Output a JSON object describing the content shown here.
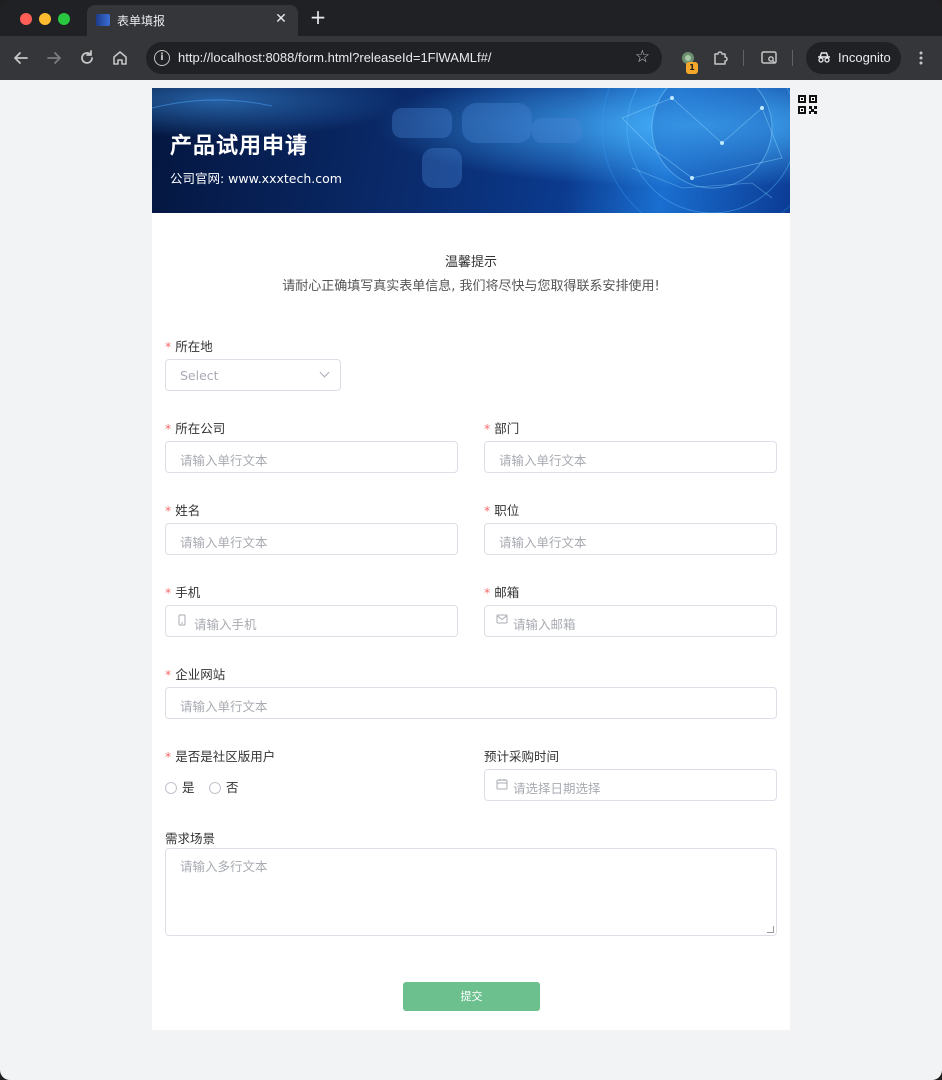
{
  "browser": {
    "tab_title": "表单填报",
    "tab_close": "✕",
    "new_tab": "+",
    "url": "http://localhost:8088/form.html?releaseId=1FlWAMLf#/",
    "extension_badge": "1",
    "incognito_label": "Incognito"
  },
  "banner": {
    "title": "产品试用申请",
    "subtitle": "公司官网: www.xxxtech.com"
  },
  "tip": {
    "title": "温馨提示",
    "text": "请耐心正确填写真实表单信息, 我们将尽快与您取得联系安排使用!"
  },
  "form": {
    "required_mark": "*",
    "location": {
      "label": "所在地",
      "placeholder": "Select"
    },
    "company": {
      "label": "所在公司",
      "placeholder": "请输入单行文本"
    },
    "department": {
      "label": "部门",
      "placeholder": "请输入单行文本"
    },
    "name": {
      "label": "姓名",
      "placeholder": "请输入单行文本"
    },
    "position": {
      "label": "职位",
      "placeholder": "请输入单行文本"
    },
    "phone": {
      "label": "手机",
      "placeholder": "请输入手机"
    },
    "email": {
      "label": "邮箱",
      "placeholder": "请输入邮箱"
    },
    "website": {
      "label": "企业网站",
      "placeholder": "请输入单行文本"
    },
    "community_user": {
      "label": "是否是社区版用户",
      "options": [
        "是",
        "否"
      ]
    },
    "purchase_time": {
      "label": "预计采购时间",
      "placeholder": "请选择日期选择"
    },
    "requirement": {
      "label": "需求场景",
      "placeholder": "请输入多行文本"
    },
    "submit_label": "提交"
  },
  "colors": {
    "required": "#f56c6c",
    "submit": "#6cc08e",
    "banner_dark": "#04163f",
    "banner_light": "#1a6fd0"
  }
}
